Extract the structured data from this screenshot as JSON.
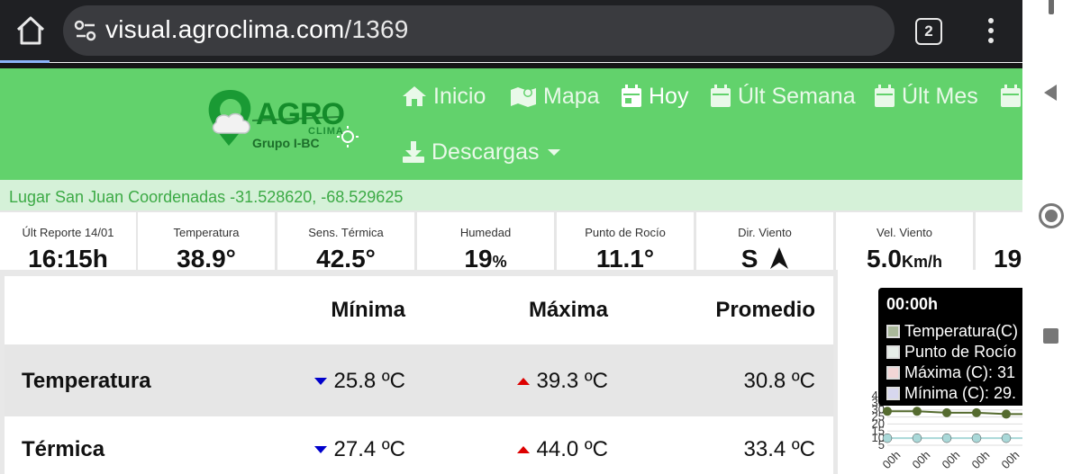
{
  "browser": {
    "url_domain": "visual.agroclima.com",
    "url_path": "/1369",
    "tab_count": "2"
  },
  "site": {
    "logo": {
      "word": "AGRO",
      "sub": "CLIMA",
      "group": "Grupo I-BC"
    },
    "nav": [
      {
        "label": "Inicio",
        "icon": "home-icon",
        "active": false
      },
      {
        "label": "Mapa",
        "icon": "map-icon",
        "active": false
      },
      {
        "label": "Hoy",
        "icon": "calendar-icon",
        "active": true
      },
      {
        "label": "Últ Semana",
        "icon": "calendar-icon",
        "active": false
      },
      {
        "label": "Últ Mes",
        "icon": "calendar-icon",
        "active": false
      },
      {
        "label": "Descargas",
        "icon": "download-icon",
        "active": false
      }
    ],
    "location": "Lugar San Juan Coordenadas -31.528620, -68.529625"
  },
  "metrics": [
    {
      "label": "Últ Reporte 14/01",
      "value": "16:15h",
      "unit": ""
    },
    {
      "label": "Temperatura",
      "value": "38.9°",
      "unit": ""
    },
    {
      "label": "Sens. Térmica",
      "value": "42.5°",
      "unit": ""
    },
    {
      "label": "Humedad",
      "value": "19",
      "unit": "%"
    },
    {
      "label": "Punto de Rocío",
      "value": "11.1°",
      "unit": ""
    },
    {
      "label": "Dir. Viento",
      "value": "S",
      "unit": ""
    },
    {
      "label": "Vel. Viento",
      "value": "5.0",
      "unit": "Km/h"
    },
    {
      "label": "",
      "value": "19",
      "unit": ""
    }
  ],
  "stats_table": {
    "headers": [
      "Mínima",
      "Máxima",
      "Promedio"
    ],
    "rows": [
      {
        "name": "Temperatura",
        "min": "25.8 ºC",
        "max": "39.3 ºC",
        "avg": "30.8 ºC"
      },
      {
        "name": "Térmica",
        "min": "27.4 ºC",
        "max": "44.0 ºC",
        "avg": "33.4 ºC"
      }
    ]
  },
  "chart_tooltip": {
    "title": "00:00h",
    "items": [
      {
        "label": "Temperatura(C)",
        "color": "#a9b89a"
      },
      {
        "label": "Punto de Rocío",
        "color": "#e6ede8"
      },
      {
        "label": "Máxima (C): 31",
        "color": "#f2d6d6"
      },
      {
        "label": "Mínima (C): 29.",
        "color": "#d7d7ee"
      }
    ]
  },
  "chart_data": {
    "type": "line",
    "y_tick_labels": [
      "40",
      "35",
      "30",
      "25",
      "20",
      "15",
      "10",
      "5"
    ],
    "x_tick_labels": [
      "00h",
      "00h",
      "00h",
      "00h",
      "00h",
      "00h"
    ],
    "ylim": [
      5,
      40
    ],
    "series": [
      {
        "values": [
          29,
          29,
          28,
          28,
          27,
          27
        ],
        "color": "#556b2f"
      },
      {
        "values": [
          10,
          10,
          10,
          10,
          10,
          10
        ],
        "color": "#a9d8d8"
      }
    ]
  }
}
